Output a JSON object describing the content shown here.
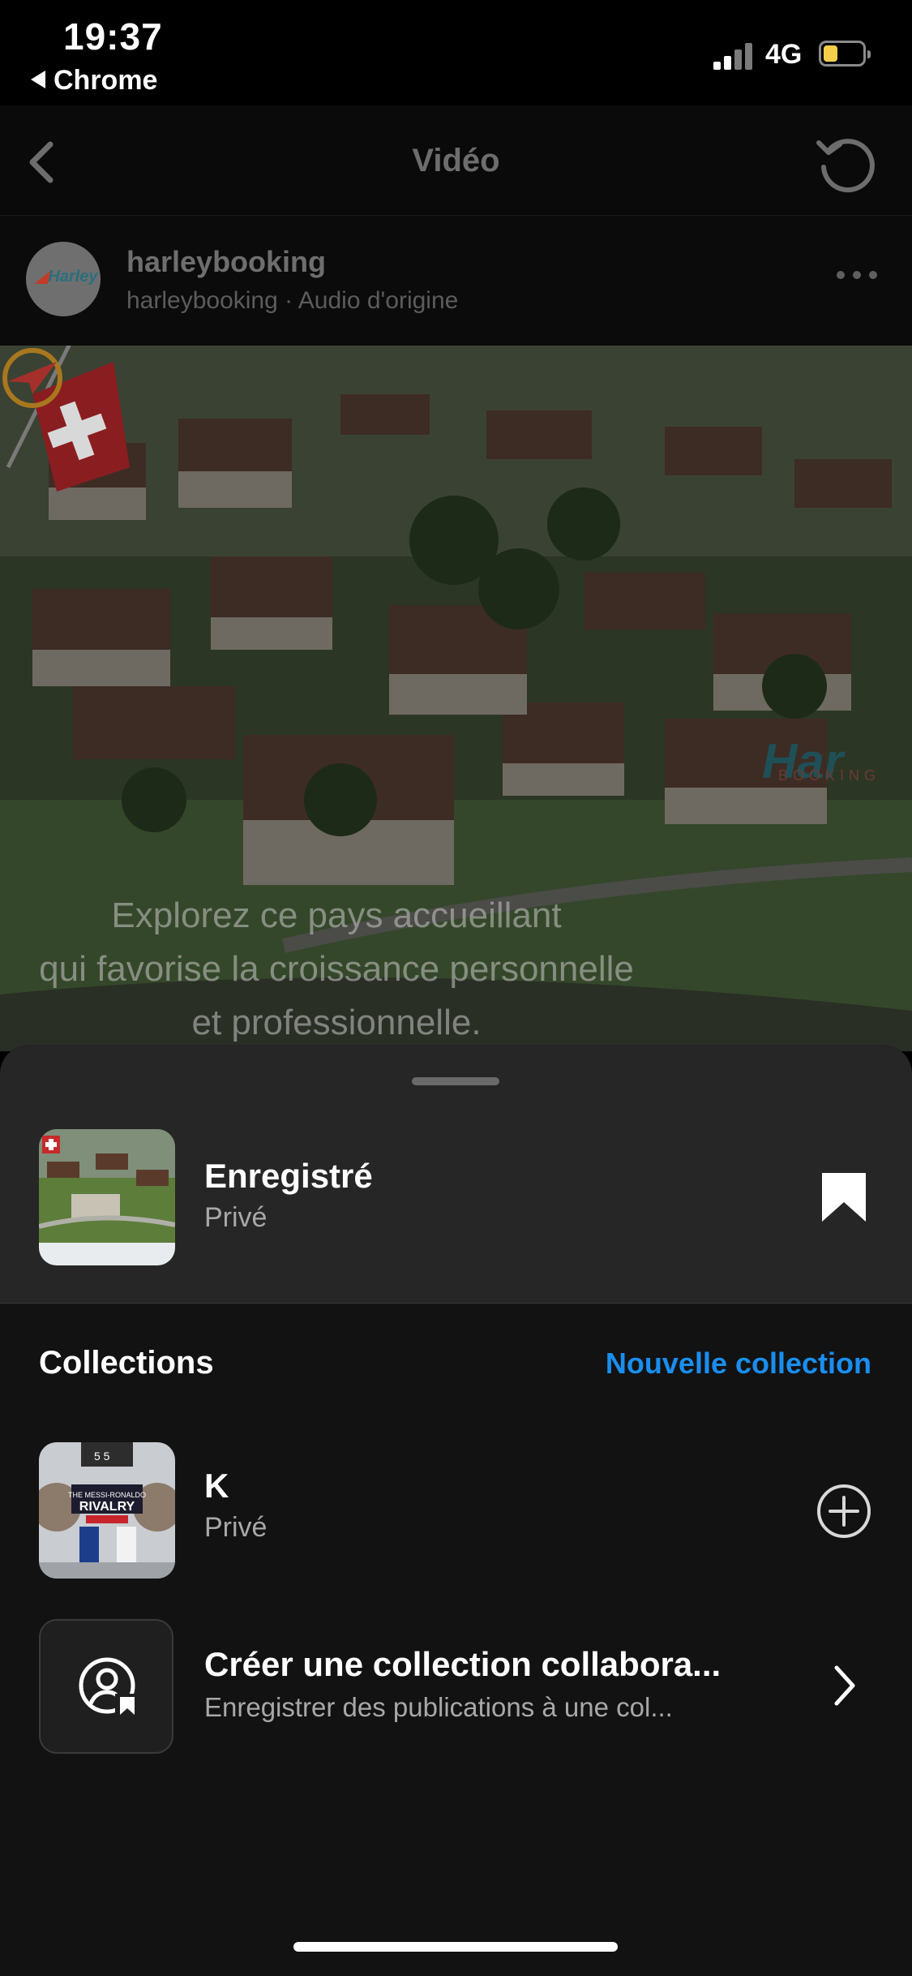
{
  "status_bar": {
    "time": "19:37",
    "back_app": "Chrome",
    "network": "4G",
    "battery_level": 0.38
  },
  "nav": {
    "title": "Vidéo",
    "back_icon": "chevron-left-icon",
    "refresh_icon": "refresh-icon"
  },
  "post": {
    "username": "harleybooking",
    "subtitle": "harleybooking · Audio d'origine",
    "more_icon": "more-dots-icon"
  },
  "video": {
    "caption_lines": [
      "Explorez ce pays accueillant",
      "qui favorise la croissance personnelle",
      "et professionnelle."
    ]
  },
  "saved": {
    "title": "Enregistré",
    "privacy": "Privé",
    "icon": "bookmark-filled-icon"
  },
  "collections": {
    "heading": "Collections",
    "new_collection_label": "Nouvelle collection",
    "items": [
      {
        "name": "K",
        "privacy": "Privé",
        "action_icon": "add-circle-icon"
      },
      {
        "name": "Créer une collection collabora...",
        "description": "Enregistrer des publications à une col...",
        "action_icon": "chevron-right-icon"
      }
    ]
  },
  "colors": {
    "accent": "#1a8ef0",
    "sheet_bg": "#121212",
    "sheet_top_bg": "#262626",
    "secondary_text": "#a8a8a8"
  }
}
